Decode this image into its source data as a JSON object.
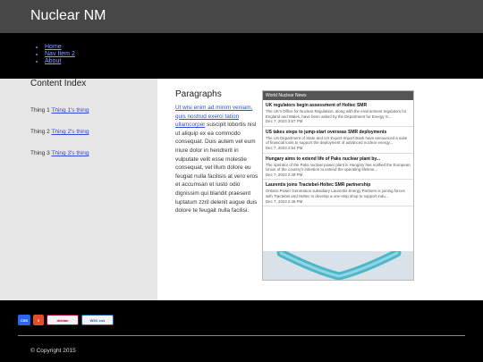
{
  "site": {
    "title": "Nuclear NM"
  },
  "nav": {
    "items": [
      "Home",
      "Nav Item 2",
      "About"
    ]
  },
  "sidebar": {
    "title": "Content Index",
    "things": [
      {
        "label": "Thing 1",
        "link": "Thing 1's thing"
      },
      {
        "label": "Thing 2",
        "link": "Thing 2's thing"
      },
      {
        "label": "Thing 3",
        "link": "Thing 3's thing"
      }
    ]
  },
  "main": {
    "paragraphs_title": "Paragraphs",
    "link_text": "Ut wisi enim ad minim veniam, quis nostrud exerci tation ullamcorper",
    "body_text": " suscipit lobortis nisl ut aliquip ex ea commodo consequat. Duis autem vel eum iriure dolor in hendrerit in vulputate velit esse molestie consequat, vel illum dolore eu feugiat nulla facilisis at vero eros et accumsan et iusto odio dignissim qui blandit praesent luptatum zzril delenit augue duis dolore te feugait nulla facilisi."
  },
  "feed": {
    "title": "World Nuclear News",
    "items": [
      {
        "title": "UK regulators begin assessment of Holtec SMR",
        "body": "The UK's Office for Nuclear Regulation, along with the environment regulators for England and Wales, have been asked by the Department for Energy S...",
        "date": "Dec 7, 2023 3:57 PM"
      },
      {
        "title": "US takes steps to jump-start overseas SMR deployments",
        "body": "The US Department of State and US Export-Import Bank have announced a suite of financial tools to support the deployment of advanced nuclear energy...",
        "date": "Dec 7, 2023 2:54 PM"
      },
      {
        "title": "Hungary aims to extend life of Paks nuclear plant by...",
        "body": "The operator of the Paks nuclear power plant in Hungary has notified the European Union of the country's intention to extend the operating lifetime...",
        "date": "Dec 7, 2023 2:49 PM"
      },
      {
        "title": "Laurentis joins Tractebel-Holtec SMR partnership",
        "body": "Ontario Power Generation subsidiary Laurentis Energy Partners is joining forces with Tractebel and Holtec to develop a one-stop shop to support indu...",
        "date": "Dec 7, 2023 2:46 PM"
      }
    ]
  },
  "footer": {
    "badges": {
      "css3": "CSS",
      "html5": "5",
      "debian": "debian",
      "w3c": "W3C css"
    },
    "copyright": "© Copyright 2015"
  }
}
